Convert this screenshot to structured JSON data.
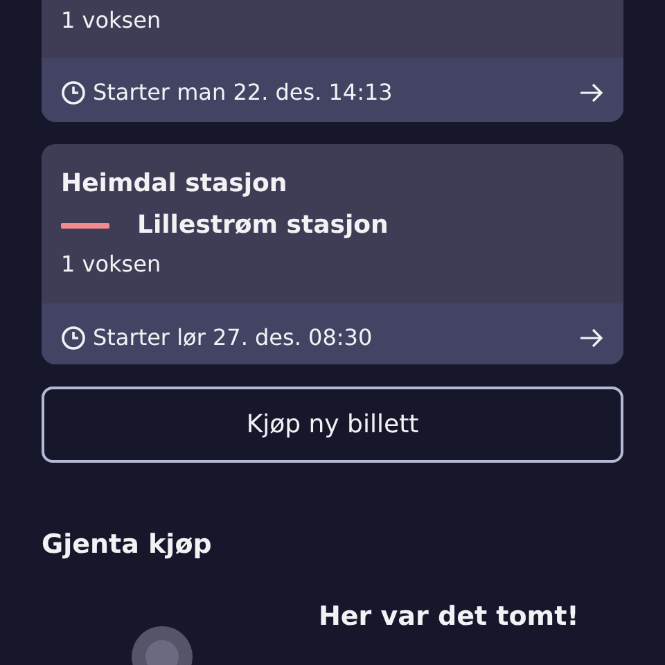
{
  "tickets": [
    {
      "passengers": "1 voksen",
      "start": "Starter man 22. des. 14:13"
    },
    {
      "from": "Heimdal stasjon",
      "to": "Lillestrøm stasjon",
      "passengers": "1 voksen",
      "start": "Starter lør 27. des. 08:30"
    }
  ],
  "buy_button": "Kjøp ny billett",
  "repeat_section": {
    "title": "Gjenta kjøp",
    "empty_title": "Her var det tomt!"
  }
}
